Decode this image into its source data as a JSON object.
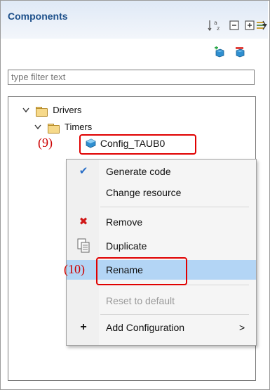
{
  "panel": {
    "title": "Components",
    "toolbar": {
      "sort_glyph": "a z",
      "collapse_glyph": "−",
      "expand_glyph": "+",
      "filter_glyph": "⇶",
      "menu_glyph": "▾"
    },
    "add_icons": [
      "add-component-icon",
      "remove-component-icon"
    ]
  },
  "filter": {
    "placeholder": "type filter text"
  },
  "tree": {
    "items": [
      {
        "label": "Drivers",
        "chevron": "∨"
      },
      {
        "label": "Timers",
        "chevron": "∨"
      },
      {
        "label": "Config_TAUB0"
      }
    ]
  },
  "annotations": {
    "step9": "(9)",
    "step10": "(10)"
  },
  "context_menu": {
    "items": [
      {
        "label": "Generate code",
        "icon": "checkmark-icon",
        "glyph": "✔"
      },
      {
        "label": "Change resource",
        "icon": "",
        "glyph": ""
      },
      {
        "label": "Remove",
        "icon": "remove-icon",
        "glyph": "✖"
      },
      {
        "label": "Duplicate",
        "icon": "duplicate-icon",
        "glyph": "⎘"
      },
      {
        "label": "Rename",
        "icon": "",
        "glyph": ""
      },
      {
        "label": "Reset to default",
        "icon": "",
        "glyph": ""
      },
      {
        "label": "Add Configuration",
        "icon": "plus-icon",
        "glyph": "+",
        "submenu_glyph": ">"
      }
    ]
  },
  "colors": {
    "title": "#1c4f8a",
    "annotation": "#cc0000",
    "highlight": "#b3d5f5"
  }
}
